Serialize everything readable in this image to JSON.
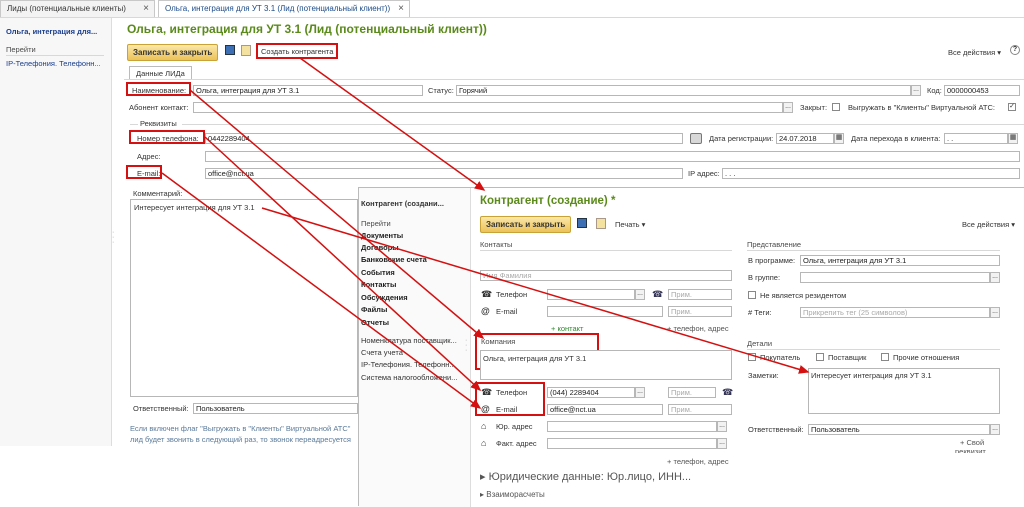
{
  "tabs": [
    {
      "label": "Лиды (потенциальные клиенты)"
    },
    {
      "label": "Ольга, интеграция для УТ 3.1 (Лид (потенциальный клиент))"
    }
  ],
  "left_nav": {
    "title": "Ольга, интеграция для...",
    "goto": "Перейти",
    "item": "IP-Телефония. Телефонн..."
  },
  "lead": {
    "title": "Ольга, интеграция для УТ 3.1 (Лид (потенциальный клиент))",
    "save_close": "Записать и закрыть",
    "create_contractor": "Создать контрагента",
    "all_actions": "Все действия ▾",
    "help": "?",
    "tab": "Данные ЛИДа",
    "name_label": "Наименование:",
    "name_value": "Ольга, интеграция для УТ 3.1",
    "status_label": "Статус:",
    "status_value": "Горячий",
    "code_label": "Код:",
    "code_value": "0000000453",
    "subscriber_label": "Абонент контакт:",
    "closed_label": "Закрыт:",
    "export_label": "Выгружать в \"Клиенты\" Виртуальной АТС:",
    "requisites": "Реквизиты",
    "phone_label": "Номер телефона:",
    "phone_value": "0442289404",
    "reg_date_label": "Дата регистрации:",
    "reg_date_value": "24.07.2018",
    "transfer_label": "Дата перехода в клиента:",
    "transfer_value": ". .",
    "address_label": "Адрес:",
    "email_label": "E-mail:",
    "email_value": "office@nct.ua",
    "ip_label": "IP адрес:",
    "ip_value": ". . .",
    "comment_label": "Комментарий:",
    "comment_value": "Интересует интеграция для УТ 3.1",
    "resp_label": "Ответственный:",
    "resp_value": "Пользователь",
    "note1": "Если включен флаг \"Выгружать в \"Клиенты\" Виртуальной АТС\"",
    "note2": "лид будет звонить в следующий раз, то звонок переадресуется"
  },
  "contractor_nav": {
    "title": "Контрагент (создани...",
    "goto": "Перейти",
    "items": [
      "Документы",
      "Договоры",
      "Банковские счета",
      "События",
      "Контакты",
      "Обсуждения",
      "Файлы",
      "Отчеты"
    ],
    "links": [
      "Номенклатура поставщик...",
      "Счета учета",
      "IP-Телефония. Телефонн...",
      "Система налогообложени..."
    ]
  },
  "contractor": {
    "title": "Контрагент (создание) *",
    "save_close": "Записать и закрыть",
    "print": "Печать ▾",
    "all_actions": "Все действия ▾",
    "contacts": "Контакты",
    "name_placeholder": "Имя Фамилия",
    "phone_label": "Телефон",
    "email_label": "E-mail",
    "note_placeholder": "Прим.",
    "add_contact": "+ контакт",
    "add_phone": "+ телефон, адрес",
    "company": "Компания",
    "company_value": "Ольга, интеграция для УТ 3.1",
    "phone_value": "(044) 2289404",
    "email_value": "office@nct.ua",
    "legal_addr": "Юр. адрес",
    "fact_addr": "Факт. адрес",
    "legal_data": "Юридические данные: Юр.лицо, ИНН...",
    "settlements": "Взаиморасчеты",
    "representation": "Представление",
    "in_program_label": "В программе:",
    "in_program_value": "Ольга, интеграция для УТ 3.1",
    "in_group_label": "В группе:",
    "not_resident": "Не является резидентом",
    "tags_label": "# Теги:",
    "tags_placeholder": "Прикрепить тег (25 символов)",
    "details": "Детали",
    "buyer": "Покупатель",
    "supplier": "Поставщик",
    "other": "Прочие отношения",
    "notes_label": "Заметки:",
    "notes_value": "Интересует интеграция для УТ 3.1",
    "resp_label": "Ответственный:",
    "resp_value": "Пользователь",
    "own_link": "+ Свой",
    "own_link2": "реквизит"
  }
}
